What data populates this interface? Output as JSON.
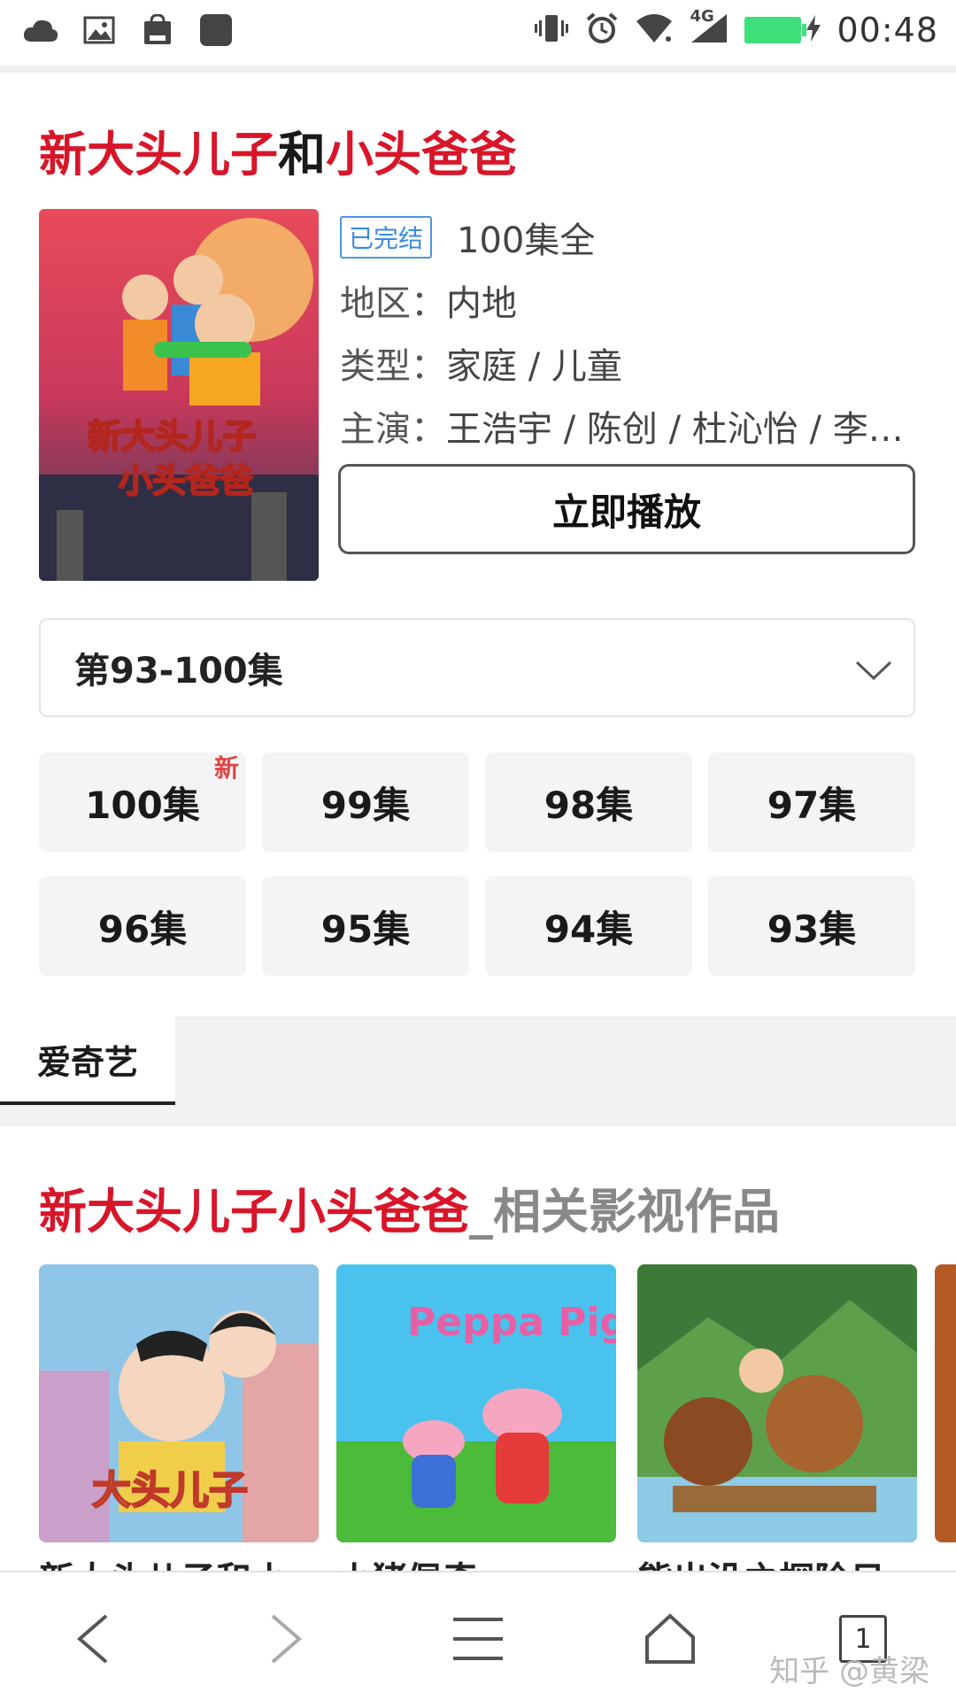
{
  "status_bar": {
    "time": "00:48",
    "network": "4G",
    "left_icons": [
      "cloud-icon",
      "image-icon",
      "shopping-bag-icon",
      "app-square-icon"
    ],
    "right_icons": [
      "vibrate-icon",
      "alarm-icon",
      "wifi-icon",
      "signal-icon",
      "battery-icon"
    ]
  },
  "show": {
    "title_part1": "新大头儿子",
    "title_part2": "和",
    "title_part3": "小头爸爸",
    "status_badge": "已完结",
    "episodes_total": "100集全",
    "region_label": "地区：",
    "region_value": "内地",
    "genre_label": "类型：",
    "genre_value": "家庭 / 儿童",
    "cast_label": "主演：",
    "cast_value": "王浩宇 / 陈创 / 杜沁怡 / 李…",
    "play_label": "立即播放"
  },
  "episode_range": {
    "selected": "第93-100集"
  },
  "episodes": [
    {
      "label": "100集",
      "new_badge": "新"
    },
    {
      "label": "99集"
    },
    {
      "label": "98集"
    },
    {
      "label": "97集"
    },
    {
      "label": "96集"
    },
    {
      "label": "95集"
    },
    {
      "label": "94集"
    },
    {
      "label": "93集"
    }
  ],
  "source_tab": "爱奇艺",
  "related": {
    "title_red": "新大头儿子小头爸爸",
    "title_gray": "_相关影视作品",
    "items": [
      {
        "label": "新大头儿子和小…"
      },
      {
        "label": "小猪佩奇"
      },
      {
        "label": "熊出没之探险日…"
      }
    ]
  },
  "bottom_nav": {
    "tab_count": "1",
    "icons": [
      "back-icon",
      "forward-icon",
      "menu-icon",
      "home-icon",
      "tabs-icon"
    ]
  },
  "watermark": "知乎 @黄梁",
  "colors": {
    "accent_red": "#d8162a",
    "badge_blue": "#3b8ae0",
    "battery_green": "#3ee07a"
  }
}
